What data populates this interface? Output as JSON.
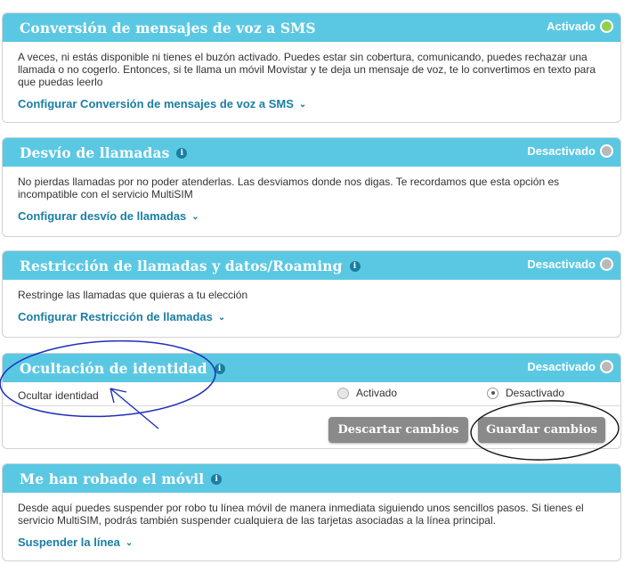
{
  "cards": [
    {
      "title": "Conversión de mensajes de voz a SMS",
      "status": "Activado",
      "description": "A veces, ni estás disponible ni tienes el buzón activado. Puedes estar sin cobertura, comunicando, puedes rechazar una llamada o no cogerlo. Entonces, si te llama un móvil Movistar y te deja un mensaje de voz, te lo convertimos en texto para que puedas leerlo",
      "link": "Configurar Conversión de mensajes de voz a SMS"
    },
    {
      "title": "Desvío de llamadas",
      "status": "Desactivado",
      "description": "No pierdas llamadas por no poder atenderlas. Las desviamos donde nos digas. Te recordamos que esta opción es incompatible con el servicio MultiSIM",
      "link": "Configurar desvío de llamadas"
    },
    {
      "title": "Restricción de llamadas y datos/Roaming",
      "status": "Desactivado",
      "description": "Restringe las llamadas que quieras a tu elección",
      "link": "Configurar Restricción de llamadas"
    },
    {
      "title": "Ocultación de identidad",
      "status": "Desactivado",
      "row_label": "Ocultar identidad",
      "option_on": "Activado",
      "option_off": "Desactivado",
      "selected": "Desactivado",
      "discard_label": "Descartar cambios",
      "save_label": "Guardar cambios"
    },
    {
      "title": "Me han robado el móvil",
      "description": "Desde aquí puedes suspender por robo tu línea móvil de manera inmediata siguiendo unos sencillos pasos. Si tienes el servicio MultiSIM, podrás también suspender cualquiera de las tarjetas asociadas a la línea principal.",
      "link": "Suspender la línea"
    }
  ],
  "colors": {
    "header": "#5bc8e3",
    "link": "#1a7ea3",
    "status_on": "#8fd14f",
    "status_off": "#b9b9b9",
    "button": "#8a8a8a",
    "annotation_blue": "#1f2fb8",
    "annotation_black": "#111111"
  },
  "icons": [
    "info-icon",
    "chevron-down-icon",
    "status-dot-icon"
  ]
}
